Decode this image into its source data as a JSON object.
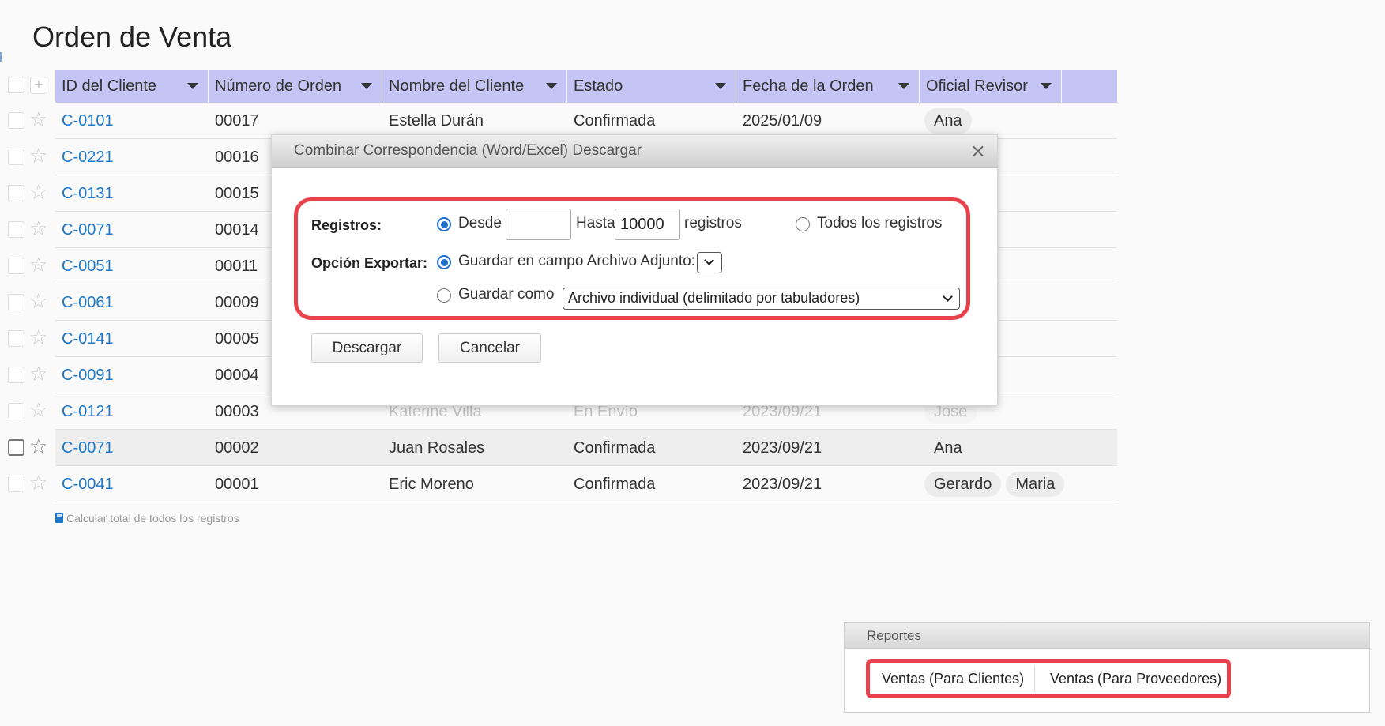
{
  "page_title": "Orden de Venta",
  "columns": [
    {
      "label": "ID del Cliente"
    },
    {
      "label": "Número de Orden"
    },
    {
      "label": "Nombre del Cliente"
    },
    {
      "label": "Estado"
    },
    {
      "label": "Fecha de la Orden"
    },
    {
      "label": "Oficial Revisor"
    }
  ],
  "rows": [
    {
      "id": "C-0101",
      "num": "00017",
      "name": "Estella Durán",
      "estado": "Confirmada",
      "fecha": "2025/01/09",
      "revisor": [
        "Ana"
      ]
    },
    {
      "id": "C-0221",
      "num": "00016",
      "name": "",
      "estado": "",
      "fecha": "",
      "revisor": []
    },
    {
      "id": "C-0131",
      "num": "00015",
      "name": "",
      "estado": "",
      "fecha": "",
      "revisor": []
    },
    {
      "id": "C-0071",
      "num": "00014",
      "name": "",
      "estado": "",
      "fecha": "",
      "revisor": []
    },
    {
      "id": "C-0051",
      "num": "00011",
      "name": "",
      "estado": "",
      "fecha": "",
      "revisor": []
    },
    {
      "id": "C-0061",
      "num": "00009",
      "name": "",
      "estado": "",
      "fecha": "",
      "revisor": []
    },
    {
      "id": "C-0141",
      "num": "00005",
      "name": "",
      "estado": "",
      "fecha": "",
      "revisor": []
    },
    {
      "id": "C-0091",
      "num": "00004",
      "name": "",
      "estado": "",
      "fecha": "",
      "revisor": []
    },
    {
      "id": "C-0121",
      "num": "00003",
      "name": "Katerine Villa",
      "estado": "En Envío",
      "fecha": "2023/09/21",
      "revisor": [
        "José"
      ]
    },
    {
      "id": "C-0071",
      "num": "00002",
      "name": "Juan Rosales",
      "estado": "Confirmada",
      "fecha": "2023/09/21",
      "revisor": [
        "Ana"
      ]
    },
    {
      "id": "C-0041",
      "num": "00001",
      "name": "Eric Moreno",
      "estado": "Confirmada",
      "fecha": "2023/09/21",
      "revisor": [
        "Gerardo",
        "Maria"
      ]
    }
  ],
  "calc_total_label": "Calcular total de todos los registros",
  "dialog": {
    "title": "Combinar Correspondencia (Word/Excel) Descargar",
    "close_icon": "×",
    "registros_label": "Registros:",
    "desde_label": "Desde",
    "desde_value": "",
    "hasta_label": "Hasta",
    "hasta_value": "10000",
    "registros_suffix": "registros",
    "todos_label": "Todos los registros",
    "opcion_label": "Opción Exportar:",
    "guardar_campo_label": "Guardar en campo Archivo Adjunto:",
    "guardar_como_label": "Guardar como",
    "guardar_como_value": "Archivo individual (delimitado por tabuladores)",
    "download_button": "Descargar",
    "cancel_button": "Cancelar",
    "selected_range": "desde",
    "selected_export": "campo",
    "highlight_color": "#e8414c"
  },
  "reports": {
    "title": "Reportes",
    "buttons": [
      "Ventas (Para Clientes)",
      "Ventas (Para Proveedores)"
    ]
  },
  "colors": {
    "header_bg": "#c5c5f5",
    "link": "#1f78c8",
    "accent_radio": "#1f6fd1"
  }
}
